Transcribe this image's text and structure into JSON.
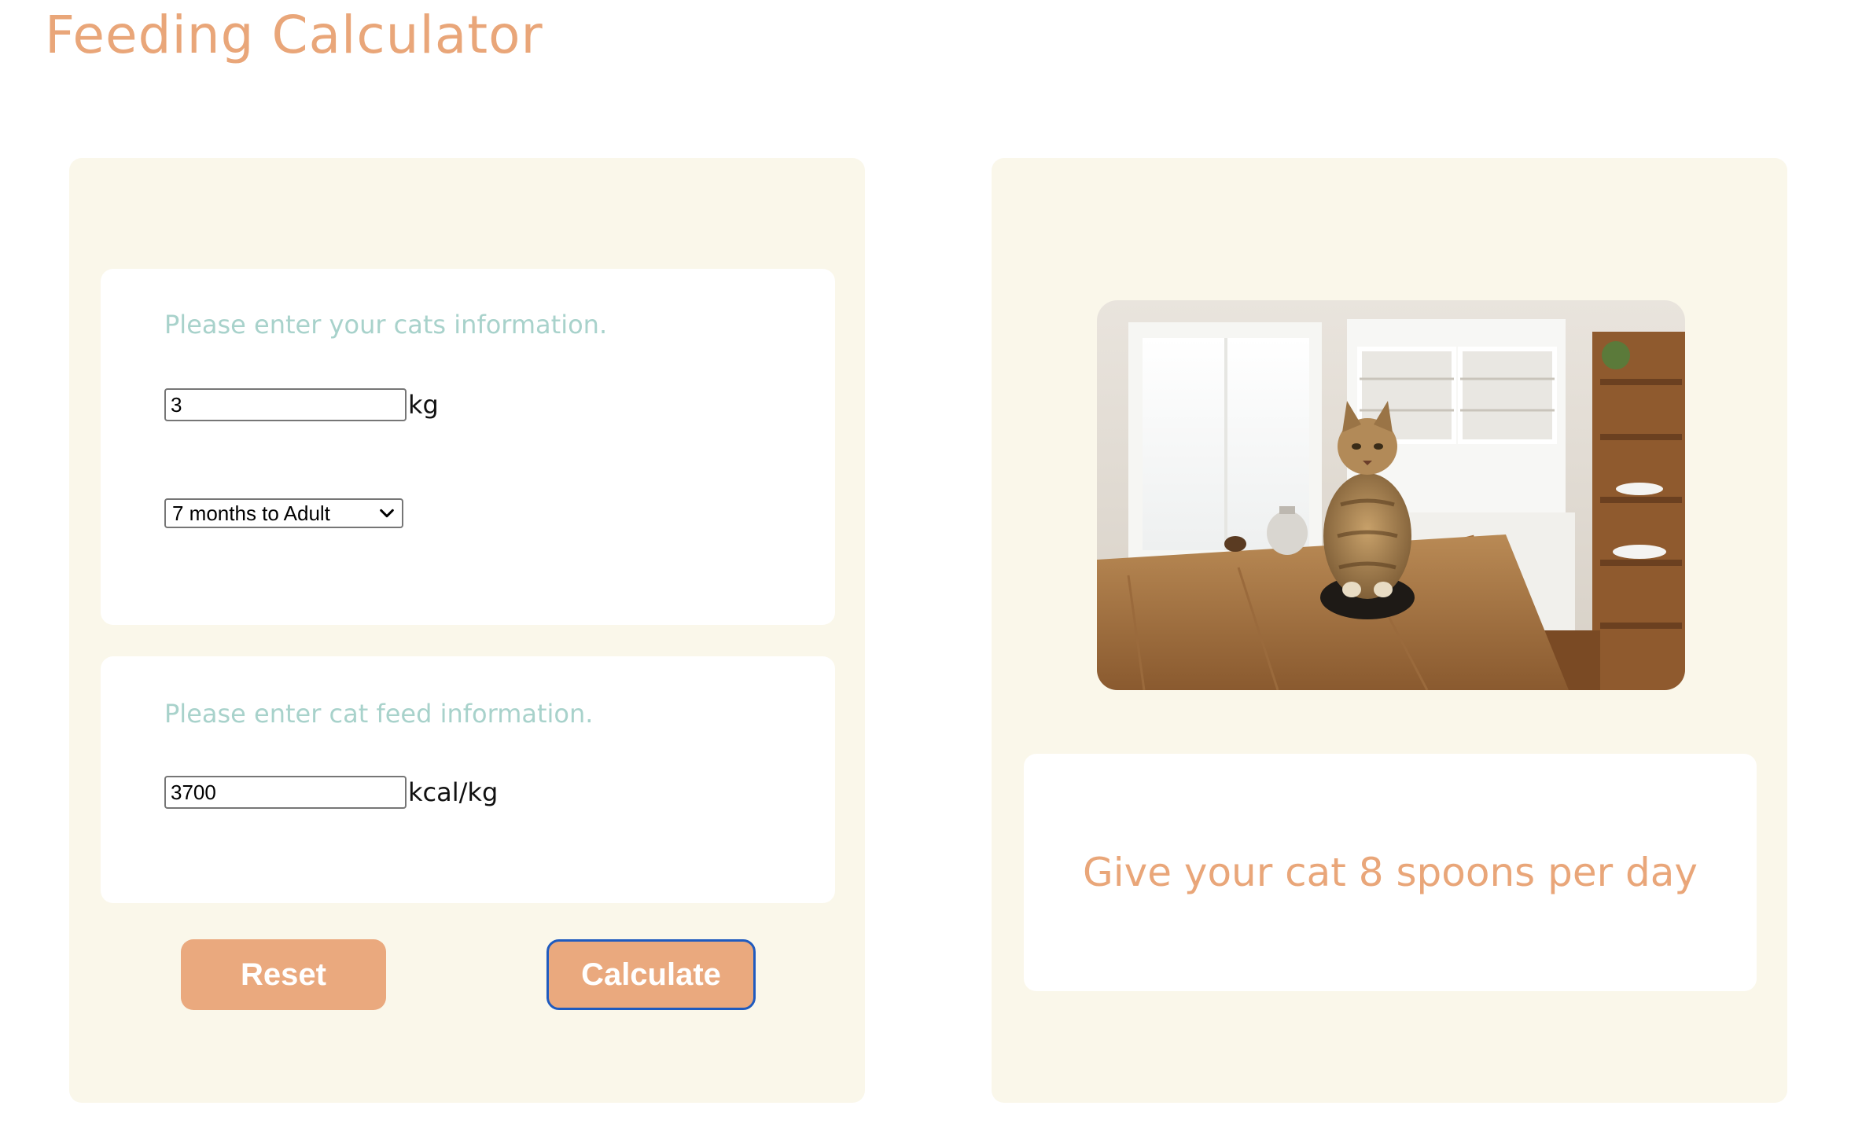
{
  "page": {
    "title": "Feeding Calculator"
  },
  "cat_info": {
    "prompt": "Please enter your cats information.",
    "weight_value": "3",
    "weight_unit": "kg",
    "age_selected": "7 months to Adult"
  },
  "feed_info": {
    "prompt": "Please enter cat feed information.",
    "calories_value": "3700",
    "calories_unit": "kcal/kg"
  },
  "buttons": {
    "reset": "Reset",
    "calculate": "Calculate"
  },
  "result": {
    "text": "Give your cat 8 spoons per day"
  },
  "image": {
    "subject": "tabby cat sitting on wooden kitchen table"
  },
  "colors": {
    "accent": "#e9a679",
    "button": "#eaa97e",
    "panel_bg": "#faf7ea",
    "prompt_text": "#a8d2cb",
    "focus_ring": "#1f5bbf"
  }
}
